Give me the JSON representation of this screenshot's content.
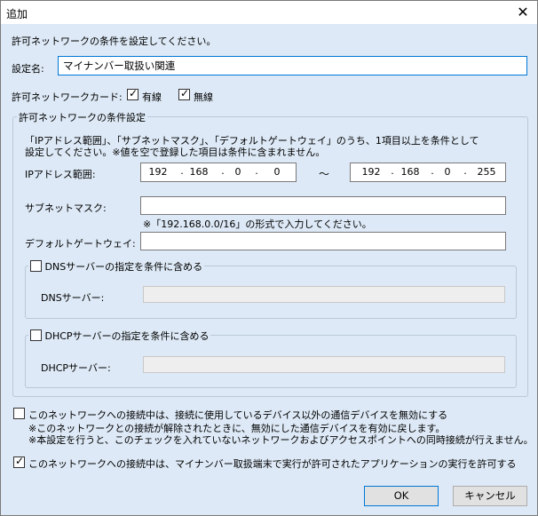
{
  "window": {
    "title": "追加"
  },
  "intro": "許可ネットワークの条件を設定してください。",
  "setting_name": {
    "label": "設定名:",
    "value": "マイナンバー取扱い関連"
  },
  "network_card": {
    "label": "許可ネットワークカード:",
    "wired": {
      "label": "有線",
      "checked": true
    },
    "wireless": {
      "label": "無線",
      "checked": true
    }
  },
  "conditions": {
    "legend": "許可ネットワークの条件設定",
    "description_line1": "「IPアドレス範囲」、「サブネットマスク」、「デフォルトゲートウェイ」のうち、1項目以上を条件として",
    "description_line2": "設定してください。※値を空で登録した項目は条件に含まれません。",
    "ip_range": {
      "label": "IPアドレス範囲:",
      "from": [
        "192",
        "168",
        "0",
        "0"
      ],
      "to": [
        "192",
        "168",
        "0",
        "255"
      ],
      "separator": "～"
    },
    "subnet": {
      "label": "サブネットマスク:",
      "value": "",
      "hint": "※「192.168.0.0/16」の形式で入力してください。"
    },
    "gateway": {
      "label": "デフォルトゲートウェイ:",
      "value": ""
    },
    "dns_group": {
      "checkbox_label": "DNSサーバーの指定を条件に含める",
      "checked": false,
      "field_label": "DNSサーバー:",
      "value": ""
    },
    "dhcp_group": {
      "checkbox_label": "DHCPサーバーの指定を条件に含める",
      "checked": false,
      "field_label": "DHCPサーバー:",
      "value": ""
    }
  },
  "disable_other_devices": {
    "label": "このネットワークへの接続中は、接続に使用しているデバイス以外の通信デバイスを無効にする",
    "checked": false,
    "note1": "※このネットワークとの接続が解除されたときに、無効にした通信デバイスを有効に戻します。",
    "note2": "※本設定を行うと、このチェックを入れていないネットワークおよびアクセスポイントへの同時接続が行えません。"
  },
  "allow_apps": {
    "label": "このネットワークへの接続中は、マイナンバー取扱端末で実行が許可されたアプリケーションの実行を許可する",
    "checked": true
  },
  "buttons": {
    "ok": "OK",
    "cancel": "キャンセル"
  }
}
